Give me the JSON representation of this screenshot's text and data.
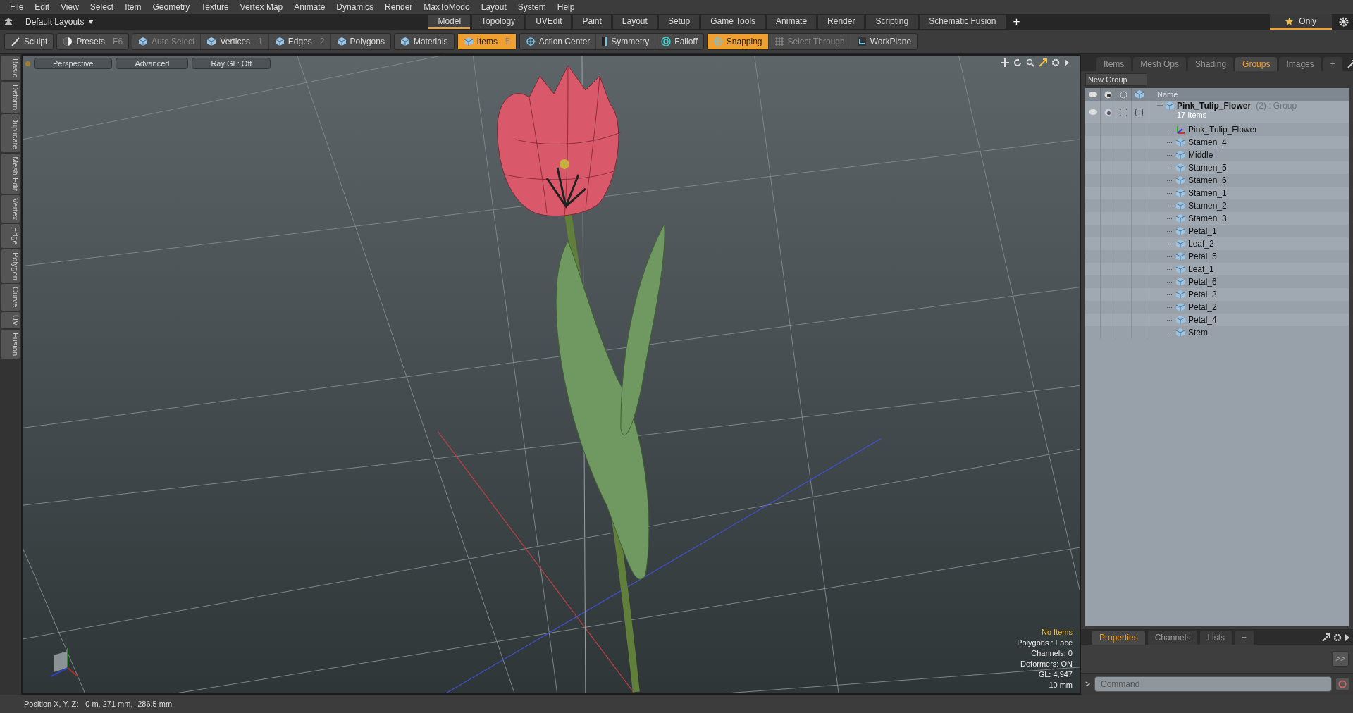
{
  "menu": [
    "File",
    "Edit",
    "View",
    "Select",
    "Item",
    "Geometry",
    "Texture",
    "Vertex Map",
    "Animate",
    "Dynamics",
    "Render",
    "MaxToModo",
    "Layout",
    "System",
    "Help"
  ],
  "layout_bar": {
    "layouts": "Default Layouts",
    "tabs": [
      {
        "label": "Model",
        "selected": true
      },
      {
        "label": "Topology",
        "selected": false
      },
      {
        "label": "UVEdit",
        "selected": false
      },
      {
        "label": "Paint",
        "selected": false
      },
      {
        "label": "Layout",
        "selected": false
      },
      {
        "label": "Setup",
        "selected": false
      },
      {
        "label": "Game Tools",
        "selected": false
      },
      {
        "label": "Animate",
        "selected": false
      },
      {
        "label": "Render",
        "selected": false
      },
      {
        "label": "Scripting",
        "selected": false
      },
      {
        "label": "Schematic Fusion",
        "selected": false
      }
    ],
    "add": "+",
    "only": "Only"
  },
  "toolbar": [
    {
      "items": [
        {
          "label": "Sculpt",
          "kind": "brush",
          "selected": false,
          "disabled": false
        }
      ]
    },
    {
      "items": [
        {
          "label": "Presets",
          "kind": "presets",
          "shortcut": "F6",
          "selected": false,
          "disabled": false
        }
      ]
    },
    {
      "items": [
        {
          "label": "Auto Select",
          "kind": "cube",
          "selected": false,
          "disabled": true
        },
        {
          "label": "Vertices",
          "kind": "cube",
          "shortcut": "1",
          "selected": false,
          "disabled": false
        },
        {
          "label": "Edges",
          "kind": "cube",
          "shortcut": "2",
          "selected": false,
          "disabled": false
        },
        {
          "label": "Polygons",
          "kind": "cube",
          "selected": false,
          "disabled": false
        }
      ]
    },
    {
      "items": [
        {
          "label": "Materials",
          "kind": "cube",
          "selected": false,
          "disabled": false
        }
      ]
    },
    {
      "items": [
        {
          "label": "Items",
          "kind": "cube",
          "shortcut": "5",
          "selected": true,
          "disabled": false
        }
      ]
    },
    {
      "items": [
        {
          "label": "Action Center",
          "kind": "crosshair",
          "selected": false,
          "disabled": false
        },
        {
          "label": "Symmetry",
          "kind": "symmetry",
          "selected": false,
          "disabled": false
        },
        {
          "label": "Falloff",
          "kind": "rings",
          "selected": false,
          "disabled": false
        }
      ]
    },
    {
      "items": [
        {
          "label": "Snapping",
          "kind": "crosshair",
          "selected": true,
          "disabled": false
        },
        {
          "label": "Select Through",
          "kind": "grid",
          "selected": false,
          "disabled": true
        },
        {
          "label": "WorkPlane",
          "kind": "plane",
          "selected": false,
          "disabled": false
        }
      ]
    }
  ],
  "left_tabs": [
    "Basic",
    "Deform",
    "Duplicate",
    "Mesh Edit",
    "Vertex",
    "Edge",
    "Polygon",
    "Curve",
    "UV",
    "Fusion"
  ],
  "viewport": {
    "buttons": [
      "Perspective",
      "Advanced",
      "Ray GL: Off"
    ],
    "info": [
      {
        "text": "No Items",
        "highlight": true
      },
      {
        "text": "Polygons : Face",
        "highlight": false
      },
      {
        "text": "Channels: 0",
        "highlight": false
      },
      {
        "text": "Deformers: ON",
        "highlight": false
      },
      {
        "text": "GL: 4,947",
        "highlight": false
      },
      {
        "text": "10 mm",
        "highlight": false
      }
    ]
  },
  "status_bar": {
    "label": "Position X, Y, Z:",
    "value": "0 m, 271 mm, -286.5 mm"
  },
  "panel": {
    "tabs": [
      {
        "label": "Items",
        "selected": false
      },
      {
        "label": "Mesh Ops",
        "selected": false
      },
      {
        "label": "Shading",
        "selected": false
      },
      {
        "label": "Groups",
        "selected": true
      },
      {
        "label": "Images",
        "selected": false
      }
    ],
    "add": "+",
    "new_group": "New Group",
    "name_column": "Name",
    "group": {
      "name": "Pink_Tulip_Flower",
      "count": "(2)",
      "type": ": Group",
      "subtitle": "17 Items",
      "expanded": true,
      "children": [
        {
          "name": "Pink_Tulip_Flower",
          "kind": "locator"
        },
        {
          "name": "Stamen_4",
          "kind": "mesh"
        },
        {
          "name": "Middle",
          "kind": "mesh"
        },
        {
          "name": "Stamen_5",
          "kind": "mesh"
        },
        {
          "name": "Stamen_6",
          "kind": "mesh"
        },
        {
          "name": "Stamen_1",
          "kind": "mesh"
        },
        {
          "name": "Stamen_2",
          "kind": "mesh"
        },
        {
          "name": "Stamen_3",
          "kind": "mesh"
        },
        {
          "name": "Petal_1",
          "kind": "mesh"
        },
        {
          "name": "Leaf_2",
          "kind": "mesh"
        },
        {
          "name": "Petal_5",
          "kind": "mesh"
        },
        {
          "name": "Leaf_1",
          "kind": "mesh"
        },
        {
          "name": "Petal_6",
          "kind": "mesh"
        },
        {
          "name": "Petal_3",
          "kind": "mesh"
        },
        {
          "name": "Petal_2",
          "kind": "mesh"
        },
        {
          "name": "Petal_4",
          "kind": "mesh"
        },
        {
          "name": "Stem",
          "kind": "mesh"
        }
      ]
    }
  },
  "bottom_panel": {
    "tabs": [
      {
        "label": "Properties",
        "selected": true
      },
      {
        "label": "Channels",
        "selected": false
      },
      {
        "label": "Lists",
        "selected": false
      }
    ],
    "add": "+",
    "more": ">>",
    "prompt": ">",
    "command": {
      "placeholder": "Command"
    }
  }
}
